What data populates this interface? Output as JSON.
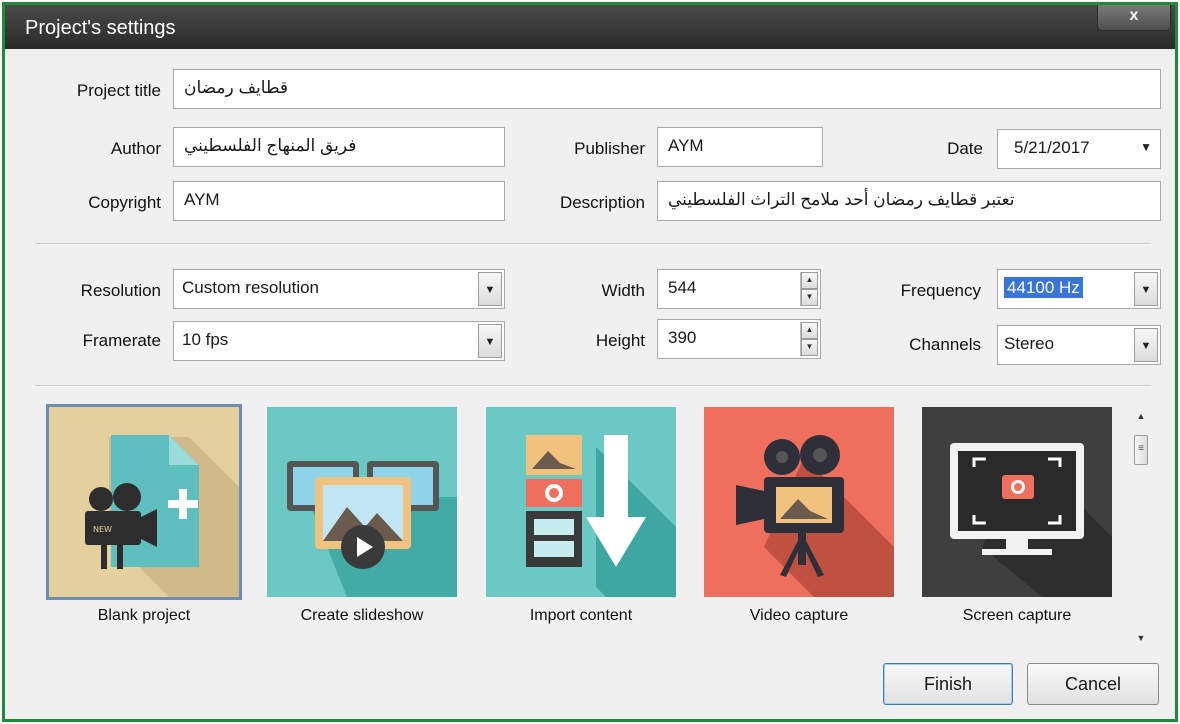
{
  "window": {
    "title": "Project's settings",
    "close_label": "x"
  },
  "fields": {
    "project_title": {
      "label": "Project title",
      "value": "قطايف رمضان"
    },
    "author": {
      "label": "Author",
      "value": "فريق المنهاج الفلسطيني"
    },
    "publisher": {
      "label": "Publisher",
      "value": "AYM"
    },
    "date": {
      "label": "Date",
      "value": "5/21/2017"
    },
    "copyright": {
      "label": "Copyright",
      "value": "AYM"
    },
    "description": {
      "label": "Description",
      "value": "تعتبر قطايف رمضان أحد ملامح التراث الفلسطيني"
    }
  },
  "media": {
    "resolution": {
      "label": "Resolution",
      "value": "Custom resolution"
    },
    "framerate": {
      "label": "Framerate",
      "value": "10 fps"
    },
    "width": {
      "label": "Width",
      "value": "544"
    },
    "height": {
      "label": "Height",
      "value": "390"
    },
    "frequency": {
      "label": "Frequency",
      "value": "44100 Hz"
    },
    "channels": {
      "label": "Channels",
      "value": "Stereo"
    }
  },
  "templates": [
    {
      "label": "Blank project",
      "icon": "blank-project-icon",
      "bg": "#e4cf9f",
      "selected": true
    },
    {
      "label": "Create slideshow",
      "icon": "slideshow-icon",
      "bg": "#6cc8c3"
    },
    {
      "label": "Import content",
      "icon": "import-content-icon",
      "bg": "#6cc8c3"
    },
    {
      "label": "Video capture",
      "icon": "video-camera-icon",
      "bg": "#ef6f5e"
    },
    {
      "label": "Screen capture",
      "icon": "screen-capture-icon",
      "bg": "#3f3f3f"
    }
  ],
  "buttons": {
    "finish": "Finish",
    "cancel": "Cancel"
  },
  "colors": {
    "window_border": "#1f8a3a",
    "titlebar": "#2a2a2a",
    "selection": "#3875d7"
  }
}
